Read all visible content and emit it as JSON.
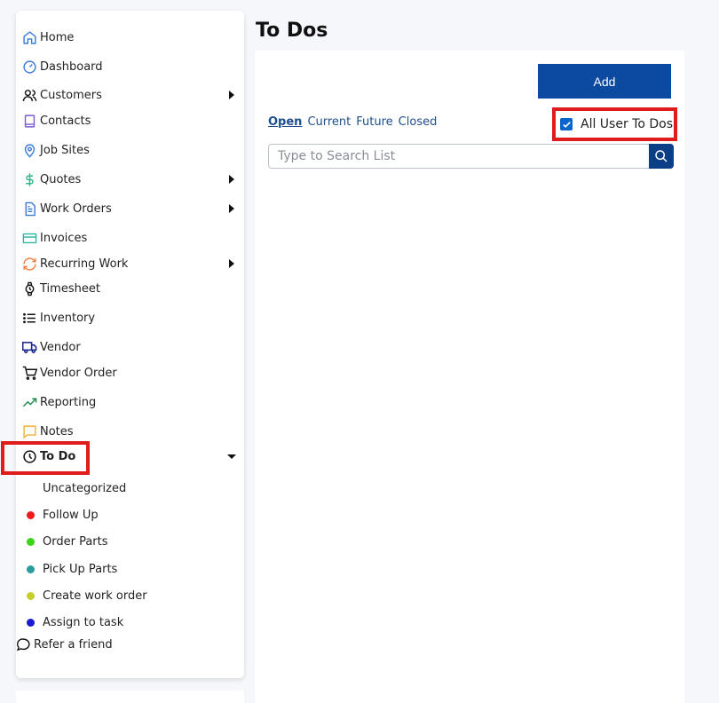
{
  "sidebar": {
    "items": [
      {
        "label": "Home",
        "icon": "home-icon",
        "color": "#3a7bd5"
      },
      {
        "label": "Dashboard",
        "icon": "dashboard-icon",
        "color": "#3a7bd5"
      },
      {
        "label": "Customers",
        "icon": "users-icon",
        "color": "#111111"
      },
      {
        "label": "Contacts",
        "icon": "book-icon",
        "color": "#7b5cd6"
      },
      {
        "label": "Job Sites",
        "icon": "map-pin-icon",
        "color": "#3a7bd5"
      },
      {
        "label": "Quotes",
        "icon": "dollar-icon",
        "color": "#2fb58a"
      },
      {
        "label": "Work Orders",
        "icon": "document-icon",
        "color": "#3a7bd5"
      },
      {
        "label": "Invoices",
        "icon": "credit-card-icon",
        "color": "#2fb5a0"
      },
      {
        "label": "Recurring Work",
        "icon": "refresh-icon",
        "color": "#f07a3a"
      },
      {
        "label": "Timesheet",
        "icon": "watch-icon",
        "color": "#111111"
      },
      {
        "label": "Inventory",
        "icon": "list-icon",
        "color": "#111111"
      },
      {
        "label": "Vendor",
        "icon": "truck-icon",
        "color": "#1b2a8c"
      },
      {
        "label": "Vendor Order",
        "icon": "cart-icon",
        "color": "#111111"
      },
      {
        "label": "Reporting",
        "icon": "trending-up-icon",
        "color": "#1e8a4a"
      },
      {
        "label": "Notes",
        "icon": "message-icon",
        "color": "#f0b03a"
      },
      {
        "label": "To Do",
        "icon": "clock-icon",
        "color": "#111111"
      }
    ],
    "todo_subitems": [
      {
        "label": "Uncategorized",
        "color": ""
      },
      {
        "label": "Follow Up",
        "color": "#ee1c1c"
      },
      {
        "label": "Order Parts",
        "color": "#3bd41b"
      },
      {
        "label": "Pick Up Parts",
        "color": "#2a9d9d"
      },
      {
        "label": "Create work order",
        "color": "#c5cf2a"
      },
      {
        "label": "Assign to task",
        "color": "#1a1acf"
      }
    ],
    "refer": {
      "label": "Refer a friend",
      "icon": "chat-bubble-icon"
    }
  },
  "main": {
    "title": "To Dos",
    "add_label": "Add",
    "tabs": [
      "Open",
      "Current",
      "Future",
      "Closed"
    ],
    "all_user_label": "All User To Dos",
    "all_user_checked": true,
    "search_placeholder": "Type to Search List"
  }
}
